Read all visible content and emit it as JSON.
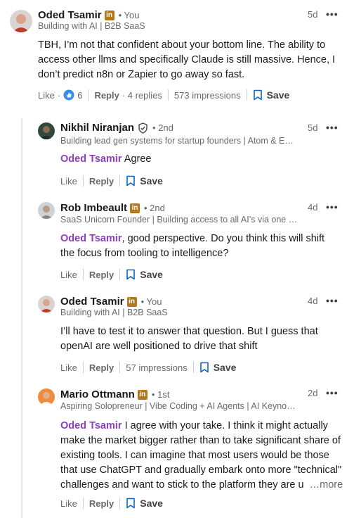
{
  "comments": [
    {
      "author": "Oded Tsamir",
      "meta": "• You",
      "headline": "Building with AI | B2B SaaS",
      "time": "5d",
      "mention": "",
      "text": "TBH, I’m not that confident about your bottom line. The ability to access other llms and specifically Claude is still massive. Hence, I don’t predict n8n or Zapier to go away so fast.",
      "like": "Like",
      "reaction_count": "6",
      "reply": "Reply",
      "replies": "· 4 replies",
      "impressions": "573 impressions",
      "save": "Save"
    },
    {
      "author": "Nikhil Niranjan",
      "meta": "• 2nd",
      "headline": "Building lead gen systems for startup founders | Atom & E…",
      "time": "5d",
      "mention": "Oded Tsamir",
      "text": " Agree",
      "like": "Like",
      "reply": "Reply",
      "save": "Save"
    },
    {
      "author": "Rob Imbeault",
      "meta": "• 2nd",
      "headline": "SaaS Unicorn Founder | Building access to all AI’s via one …",
      "time": "4d",
      "mention": "Oded Tsamir",
      "text": ", good perspective. Do you think this will shift the focus from tooling to intelligence?",
      "like": "Like",
      "reply": "Reply",
      "save": "Save"
    },
    {
      "author": "Oded Tsamir",
      "meta": "• You",
      "headline": "Building with AI | B2B SaaS",
      "time": "4d",
      "mention": "",
      "text": "I’ll have to test it to answer that question. But I guess that openAI are well positioned to drive that shift",
      "like": "Like",
      "reply": "Reply",
      "impressions": "57 impressions",
      "save": "Save"
    },
    {
      "author": "Mario Ottmann",
      "meta": "• 1st",
      "headline": "Aspiring Solopreneur | Vibe Coding + AI Agents | AI Keyno…",
      "time": "2d",
      "mention": "Oded Tsamir",
      "text": " I agree with your take. I think it might actually make the market bigger rather than to take significant share of existing tools. I can imagine that most users would be those that use ChatGPT and gradually embark onto more \"technical\" challenges and want to stick to the platform they are u",
      "more": "…more",
      "like": "Like",
      "reply": "Reply",
      "save": "Save"
    }
  ],
  "icons": {
    "linkedin_badge": "in",
    "more": "•••"
  },
  "colors": {
    "mention": "#8b3fbf",
    "badge": "#b4781c",
    "like_reaction": "#0a66c2"
  }
}
